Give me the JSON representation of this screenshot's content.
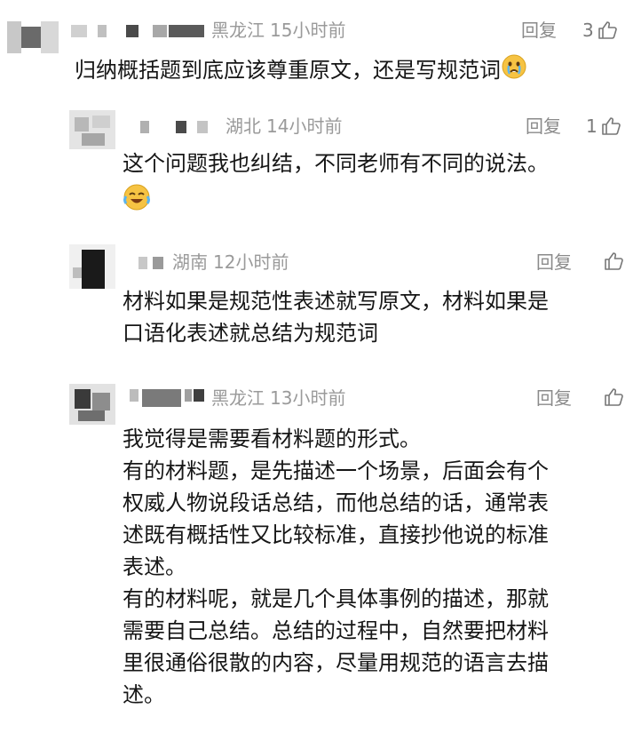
{
  "comments": [
    {
      "location": "黑龙江",
      "time": "15小时前",
      "reply_label": "回复",
      "likes": "3",
      "text": "归纳概括题到底应该尊重原文，还是写规范词",
      "emoji": "crying-face"
    },
    {
      "location": "湖北",
      "time": "14小时前",
      "reply_label": "回复",
      "likes": "1",
      "text": "这个问题我也纠结，不同老师有不同的说法。",
      "emoji": "crying-laughing-face"
    },
    {
      "location": "湖南",
      "time": "12小时前",
      "reply_label": "回复",
      "likes": "",
      "text_lines": [
        "材料如果是规范性表述就写原文，材料如果是",
        "口语化表述就总结为规范词"
      ]
    },
    {
      "location": "黑龙江",
      "time": "13小时前",
      "reply_label": "回复",
      "likes": "",
      "text_lines": [
        "我觉得是需要看材料题的形式。",
        "有的材料题，是先描述一个场景，后面会有个",
        "权威人物说段话总结，而他总结的话，通常表",
        "述既有概括性又比较标准，直接抄他说的标准",
        "表述。",
        "有的材料呢，就是几个具体事例的描述，那就",
        "需要自己总结。总结的过程中，自然要把材料",
        "里很通俗很散的内容，尽量用规范的语言去描",
        "述。"
      ]
    }
  ],
  "colors": {
    "meta": "#9a9a9a",
    "text": "#161616"
  },
  "icons": [
    "thumbs-up-icon",
    "crying-face-emoji",
    "crying-laughing-face-emoji"
  ]
}
